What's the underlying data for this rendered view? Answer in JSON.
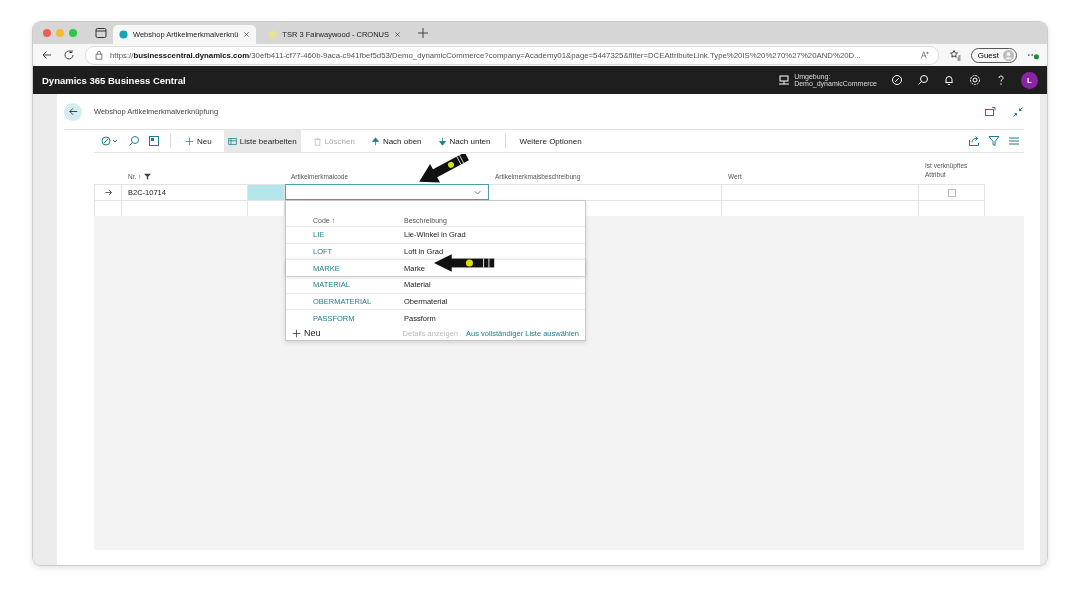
{
  "browser": {
    "tabs": [
      {
        "title": "Webshop Artikelmerkmalverknü",
        "selected": true
      },
      {
        "title": "TSR 3 Fairwaywood - CRONUS",
        "selected": false
      }
    ],
    "url": "https://**businesscentral.dynamics.com**/30efb411-cf77-460b-9aca-c941fbef5d53/Demo_dynamicCommerce?company=Academy01&page=5447325&filter=DCEAttributeLink.Type%20IS%20%270%27%20AND%20D...",
    "profile": "Guest"
  },
  "app_header": {
    "title": "Dynamics 365 Business Central",
    "environment_label": "Umgebung:",
    "environment_value": "Demo_dynamicCommerce",
    "avatar": "L"
  },
  "page": {
    "title": "Webshop Artikelmerkmalverknüpfung"
  },
  "toolbar": [
    {
      "label": "Neu",
      "kind": "new",
      "disabled": false,
      "selected": false
    },
    {
      "label": "Liste bearbeiten",
      "kind": "edit",
      "disabled": false,
      "selected": true
    },
    {
      "label": "Löschen",
      "kind": "delete",
      "disabled": true,
      "selected": false
    },
    {
      "label": "Nach oben",
      "kind": "up",
      "disabled": false,
      "selected": false
    },
    {
      "label": "Nach unten",
      "kind": "down",
      "disabled": false,
      "selected": false
    },
    {
      "label": "Weitere Optionen",
      "kind": "more",
      "disabled": false,
      "selected": false
    }
  ],
  "table": {
    "columns": [
      "Nr. ↑",
      "Artikelmerkmalcode",
      "Artikelmerkmalsbeschreibung",
      "Wert",
      "Ist verknüpftes Attribut"
    ],
    "rows": [
      {
        "current": true,
        "nr": "B2C-10714",
        "linked": false
      },
      {
        "current": false
      }
    ]
  },
  "dropdown": {
    "columns": [
      "Code ↑",
      "Beschreibung"
    ],
    "items": [
      {
        "code": "LIE",
        "description": "Lie-Winkel in Grad",
        "selected": false
      },
      {
        "code": "LOFT",
        "description": "Loft in Grad",
        "selected": false
      },
      {
        "code": "MARKE",
        "description": "Marke",
        "selected": true
      },
      {
        "code": "MATERIAL",
        "description": "Material",
        "selected": false
      },
      {
        "code": "OBERMATERIAL",
        "description": "Obermaterial",
        "selected": false
      },
      {
        "code": "PASSFORM",
        "description": "Passform",
        "selected": false
      }
    ],
    "new": "Neu",
    "details": "Details anzeigen",
    "details_disabled": true,
    "select_full": "Aus vollständiger Liste auswählen"
  }
}
